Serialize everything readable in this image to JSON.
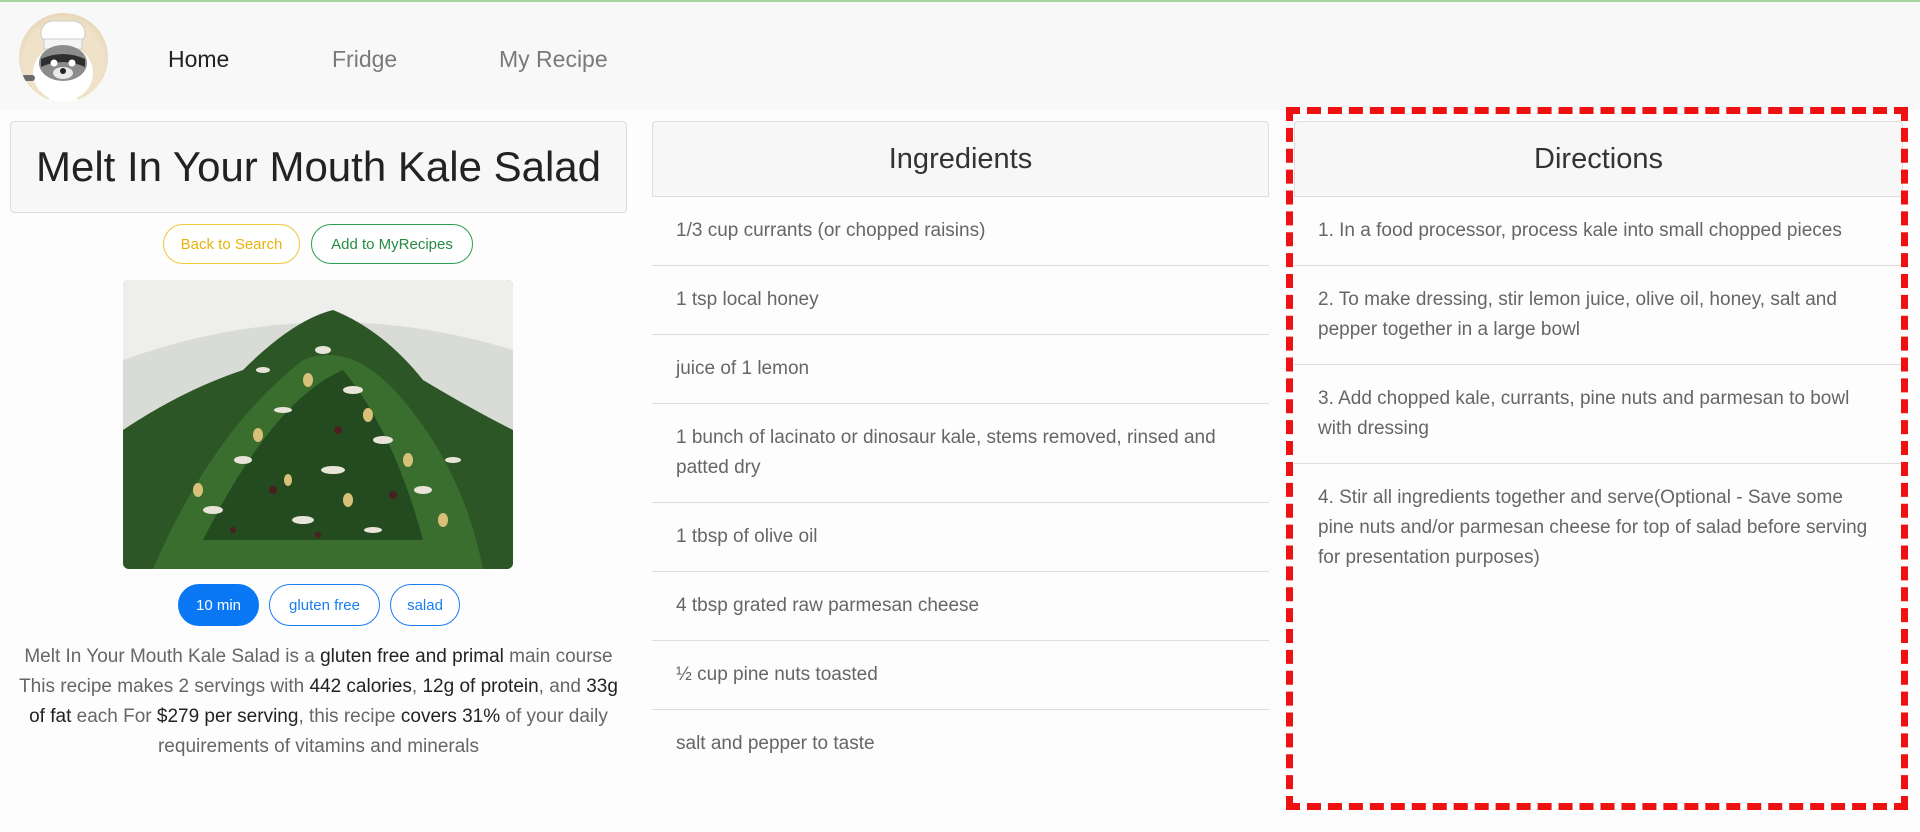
{
  "nav": {
    "home": "Home",
    "fridge": "Fridge",
    "my_recipe": "My Recipe"
  },
  "recipe": {
    "title": "Melt In Your Mouth Kale Salad",
    "back_label": "Back to Search",
    "add_label": "Add to MyRecipes",
    "tags": [
      "10 min",
      "gluten free",
      "salad"
    ],
    "summary": {
      "p1": "Melt In Your Mouth Kale Salad is a ",
      "b1": "gluten free and primal",
      "p2": " main course This recipe makes 2 servings with ",
      "b2": "442 calories",
      "p3": ", ",
      "b3": "12g of protein",
      "p4": ", and ",
      "b4": "33g of fat",
      "p5": " each For ",
      "b5": "$279 per serving",
      "p6": ", this recipe ",
      "b6": "covers 31%",
      "p7": " of your daily requirements of vitamins and minerals"
    }
  },
  "ingredients": {
    "header": "Ingredients",
    "items": [
      "1/3 cup currants (or chopped raisins)",
      "1 tsp local honey",
      "juice of 1 lemon",
      "1 bunch of lacinato or dinosaur kale, stems removed, rinsed and patted dry",
      "1 tbsp of olive oil",
      "4 tbsp grated raw parmesan cheese",
      "½ cup pine nuts toasted",
      "salt and pepper to taste"
    ]
  },
  "directions": {
    "header": "Directions",
    "items": [
      "1. In a food processor, process kale into small chopped pieces",
      "2. To make dressing, stir lemon juice, olive oil, honey, salt and pepper together in a large bowl",
      "3. Add chopped kale, currants, pine nuts and parmesan to bowl with dressing",
      "4. Stir all ingredients together and serve(Optional - Save some pine nuts and/or parmesan cheese for top of salad before serving for presentation purposes)"
    ]
  },
  "colors": {
    "highlight": "#ee1111",
    "primary": "#0a78f5",
    "warning": "#f3c53b",
    "success": "#2f9e52"
  }
}
